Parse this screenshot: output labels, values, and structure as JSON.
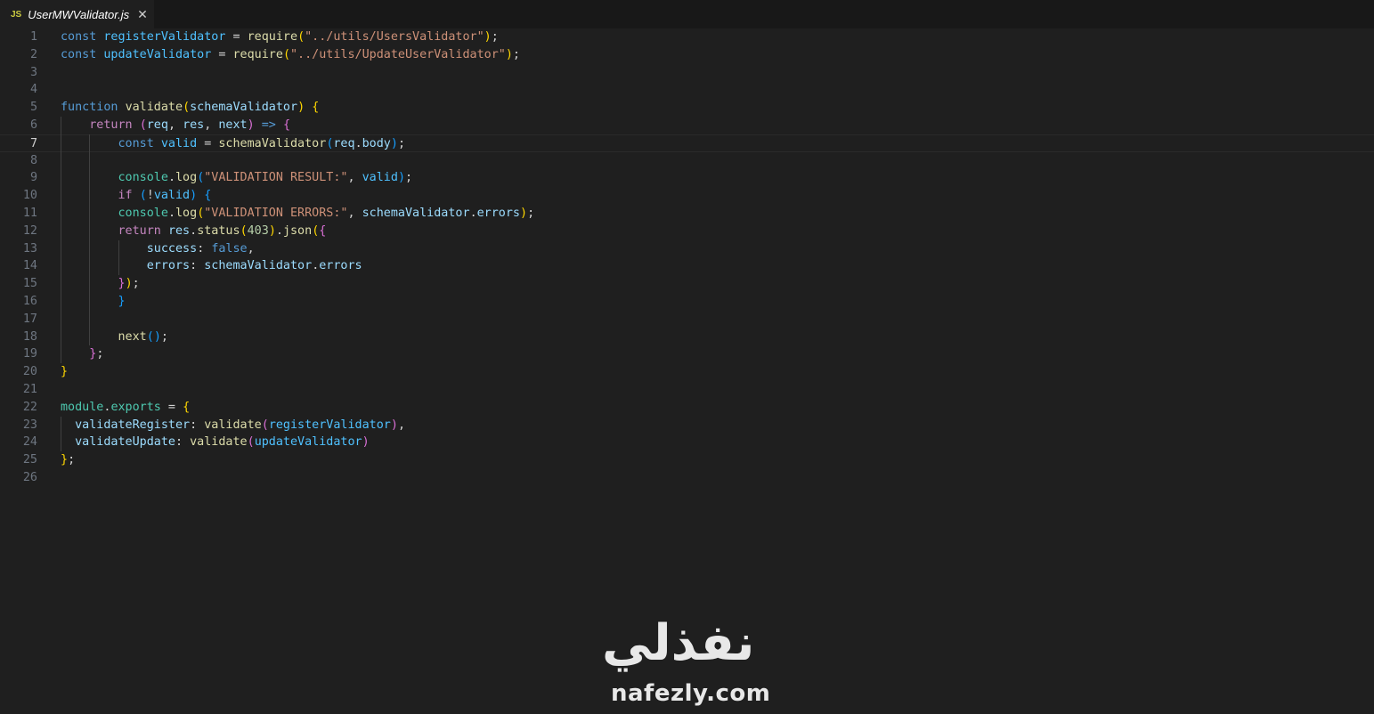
{
  "tab": {
    "icon_label": "JS",
    "filename": "UserMWValidator.js",
    "close_glyph": "✕"
  },
  "editor": {
    "current_line": 7,
    "lines": [
      {
        "n": "1",
        "t": [
          [
            "kw",
            "const"
          ],
          [
            "p",
            " "
          ],
          [
            "var",
            "registerValidator"
          ],
          [
            "p",
            " = "
          ],
          [
            "fn",
            "require"
          ],
          [
            "b1",
            "("
          ],
          [
            "str",
            "\"../utils/UsersValidator\""
          ],
          [
            "b1",
            ")"
          ],
          [
            "p",
            ";"
          ]
        ]
      },
      {
        "n": "2",
        "t": [
          [
            "kw",
            "const"
          ],
          [
            "p",
            " "
          ],
          [
            "var",
            "updateValidator"
          ],
          [
            "p",
            " = "
          ],
          [
            "fn",
            "require"
          ],
          [
            "b1",
            "("
          ],
          [
            "str",
            "\"../utils/UpdateUserValidator\""
          ],
          [
            "b1",
            ")"
          ],
          [
            "p",
            ";"
          ]
        ]
      },
      {
        "n": "3",
        "t": []
      },
      {
        "n": "4",
        "t": []
      },
      {
        "n": "5",
        "t": [
          [
            "kw",
            "function"
          ],
          [
            "p",
            " "
          ],
          [
            "fn",
            "validate"
          ],
          [
            "b1",
            "("
          ],
          [
            "par",
            "schemaValidator"
          ],
          [
            "b1",
            ")"
          ],
          [
            "p",
            " "
          ],
          [
            "b1",
            "{"
          ]
        ]
      },
      {
        "n": "6",
        "t": [
          [
            "p",
            "    "
          ],
          [
            "ctl",
            "return"
          ],
          [
            "p",
            " "
          ],
          [
            "b2",
            "("
          ],
          [
            "par",
            "req"
          ],
          [
            "p",
            ", "
          ],
          [
            "par",
            "res"
          ],
          [
            "p",
            ", "
          ],
          [
            "par",
            "next"
          ],
          [
            "b2",
            ")"
          ],
          [
            "p",
            " "
          ],
          [
            "kw",
            "=>"
          ],
          [
            "p",
            " "
          ],
          [
            "b2",
            "{"
          ]
        ]
      },
      {
        "n": "7",
        "t": [
          [
            "p",
            "        "
          ],
          [
            "kw",
            "const"
          ],
          [
            "p",
            " "
          ],
          [
            "var",
            "valid"
          ],
          [
            "p",
            " = "
          ],
          [
            "fn",
            "schemaValidator"
          ],
          [
            "b3",
            "("
          ],
          [
            "par",
            "req"
          ],
          [
            "p",
            "."
          ],
          [
            "prop",
            "body"
          ],
          [
            "b3",
            ")"
          ],
          [
            "p",
            ";"
          ]
        ]
      },
      {
        "n": "8",
        "t": []
      },
      {
        "n": "9",
        "t": [
          [
            "p",
            "        "
          ],
          [
            "obj",
            "console"
          ],
          [
            "p",
            "."
          ],
          [
            "fn",
            "log"
          ],
          [
            "b3",
            "("
          ],
          [
            "str",
            "\"VALIDATION RESULT:\""
          ],
          [
            "p",
            ", "
          ],
          [
            "var",
            "valid"
          ],
          [
            "b3",
            ")"
          ],
          [
            "p",
            ";"
          ]
        ]
      },
      {
        "n": "10",
        "t": [
          [
            "p",
            "        "
          ],
          [
            "ctl",
            "if"
          ],
          [
            "p",
            " "
          ],
          [
            "b3",
            "("
          ],
          [
            "p",
            "!"
          ],
          [
            "var",
            "valid"
          ],
          [
            "b3",
            ")"
          ],
          [
            "p",
            " "
          ],
          [
            "b3",
            "{"
          ]
        ]
      },
      {
        "n": "11",
        "t": [
          [
            "p",
            "        "
          ],
          [
            "obj",
            "console"
          ],
          [
            "p",
            "."
          ],
          [
            "fn",
            "log"
          ],
          [
            "b1",
            "("
          ],
          [
            "str",
            "\"VALIDATION ERRORS:\""
          ],
          [
            "p",
            ", "
          ],
          [
            "par",
            "schemaValidator"
          ],
          [
            "p",
            "."
          ],
          [
            "prop",
            "errors"
          ],
          [
            "b1",
            ")"
          ],
          [
            "p",
            ";"
          ]
        ]
      },
      {
        "n": "12",
        "t": [
          [
            "p",
            "        "
          ],
          [
            "ctl",
            "return"
          ],
          [
            "p",
            " "
          ],
          [
            "par",
            "res"
          ],
          [
            "p",
            "."
          ],
          [
            "fn",
            "status"
          ],
          [
            "b1",
            "("
          ],
          [
            "num",
            "403"
          ],
          [
            "b1",
            ")"
          ],
          [
            "p",
            "."
          ],
          [
            "fn",
            "json"
          ],
          [
            "b1",
            "("
          ],
          [
            "b2",
            "{"
          ]
        ]
      },
      {
        "n": "13",
        "t": [
          [
            "p",
            "            "
          ],
          [
            "prop",
            "success"
          ],
          [
            "p",
            ": "
          ],
          [
            "kw",
            "false"
          ],
          [
            "p",
            ","
          ]
        ]
      },
      {
        "n": "14",
        "t": [
          [
            "p",
            "            "
          ],
          [
            "prop",
            "errors"
          ],
          [
            "p",
            ": "
          ],
          [
            "par",
            "schemaValidator"
          ],
          [
            "p",
            "."
          ],
          [
            "prop",
            "errors"
          ]
        ]
      },
      {
        "n": "15",
        "t": [
          [
            "p",
            "        "
          ],
          [
            "b2",
            "}"
          ],
          [
            "b1",
            ")"
          ],
          [
            "p",
            ";"
          ]
        ]
      },
      {
        "n": "16",
        "t": [
          [
            "p",
            "        "
          ],
          [
            "b3",
            "}"
          ]
        ]
      },
      {
        "n": "17",
        "t": []
      },
      {
        "n": "18",
        "t": [
          [
            "p",
            "        "
          ],
          [
            "fn",
            "next"
          ],
          [
            "b3",
            "("
          ],
          [
            "b3",
            ")"
          ],
          [
            "p",
            ";"
          ]
        ]
      },
      {
        "n": "19",
        "t": [
          [
            "p",
            "    "
          ],
          [
            "b2",
            "}"
          ],
          [
            "p",
            ";"
          ]
        ]
      },
      {
        "n": "20",
        "t": [
          [
            "b1",
            "}"
          ]
        ]
      },
      {
        "n": "21",
        "t": []
      },
      {
        "n": "22",
        "t": [
          [
            "obj",
            "module"
          ],
          [
            "p",
            "."
          ],
          [
            "obj",
            "exports"
          ],
          [
            "p",
            " = "
          ],
          [
            "b1",
            "{"
          ]
        ]
      },
      {
        "n": "23",
        "t": [
          [
            "p",
            "  "
          ],
          [
            "prop",
            "validateRegister"
          ],
          [
            "p",
            ": "
          ],
          [
            "fn",
            "validate"
          ],
          [
            "b2",
            "("
          ],
          [
            "var",
            "registerValidator"
          ],
          [
            "b2",
            ")"
          ],
          [
            "p",
            ","
          ]
        ]
      },
      {
        "n": "24",
        "t": [
          [
            "p",
            "  "
          ],
          [
            "prop",
            "validateUpdate"
          ],
          [
            "p",
            ": "
          ],
          [
            "fn",
            "validate"
          ],
          [
            "b2",
            "("
          ],
          [
            "var",
            "updateValidator"
          ],
          [
            "b2",
            ")"
          ]
        ]
      },
      {
        "n": "25",
        "t": [
          [
            "b1",
            "}"
          ],
          [
            "p",
            ";"
          ]
        ]
      },
      {
        "n": "26",
        "t": []
      }
    ]
  },
  "theme": {
    "kw": "#569cd6",
    "ctl": "#c586c0",
    "fn": "#dcdcaa",
    "var": "#4fc1ff",
    "par": "#9cdcfe",
    "prop": "#9cdcfe",
    "obj": "#4ec9b0",
    "str": "#ce9178",
    "num": "#b5cea8",
    "p": "#d4d4d4",
    "b1": "#ffd700",
    "b2": "#da70d6",
    "b3": "#179fff"
  },
  "watermark": {
    "arabic": "نفذلي",
    "url": "nafezly.com"
  }
}
